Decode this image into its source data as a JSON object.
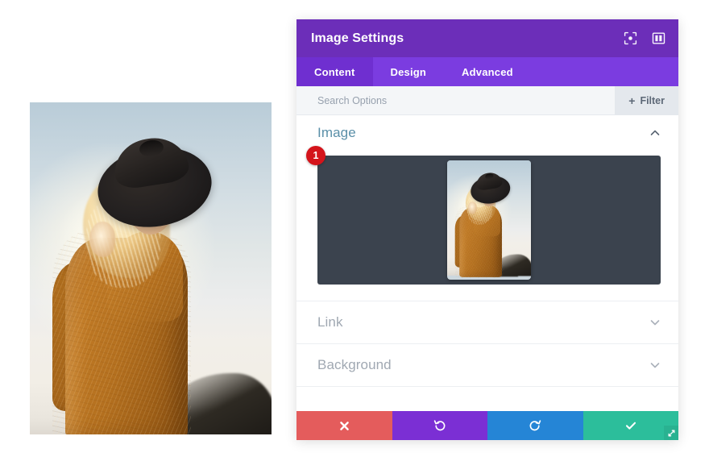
{
  "panel": {
    "title": "Image Settings",
    "header_icons": [
      {
        "name": "focus-target-icon",
        "glyph": "target"
      },
      {
        "name": "layout-columns-icon",
        "glyph": "columns"
      }
    ],
    "tabs": [
      {
        "label": "Content",
        "active": true
      },
      {
        "label": "Design",
        "active": false
      },
      {
        "label": "Advanced",
        "active": false
      }
    ],
    "search": {
      "placeholder": "Search Options",
      "value": ""
    },
    "filter_button": {
      "label": "Filter",
      "plus": "+"
    },
    "sections": [
      {
        "id": "image",
        "title": "Image",
        "expanded": true,
        "badge": "1"
      },
      {
        "id": "link",
        "title": "Link",
        "expanded": false
      },
      {
        "id": "background",
        "title": "Background",
        "expanded": false
      }
    ],
    "footer_buttons": [
      {
        "name": "cancel-button",
        "color": "#e45c5c",
        "icon": "close-x-icon"
      },
      {
        "name": "undo-button",
        "color": "#7b2fd4",
        "icon": "undo-arrow-icon"
      },
      {
        "name": "redo-button",
        "color": "#2585d6",
        "icon": "redo-arrow-icon"
      },
      {
        "name": "save-button",
        "color": "#2cbe9b",
        "icon": "checkmark-icon"
      }
    ],
    "resize_handle": "resize-grip-icon"
  },
  "canvas": {
    "image_alt": "Smiling woman in black wide-brim hat and mustard knit sweater backlit at sunset"
  },
  "colors": {
    "header_purple": "#6c2eb9",
    "tab_purple": "#7b3ce0",
    "tab_active_purple": "#6f2fd0",
    "badge_red": "#d4141b",
    "section_title_blue": "#5a8fa8",
    "drop_dark": "#3b434e"
  }
}
